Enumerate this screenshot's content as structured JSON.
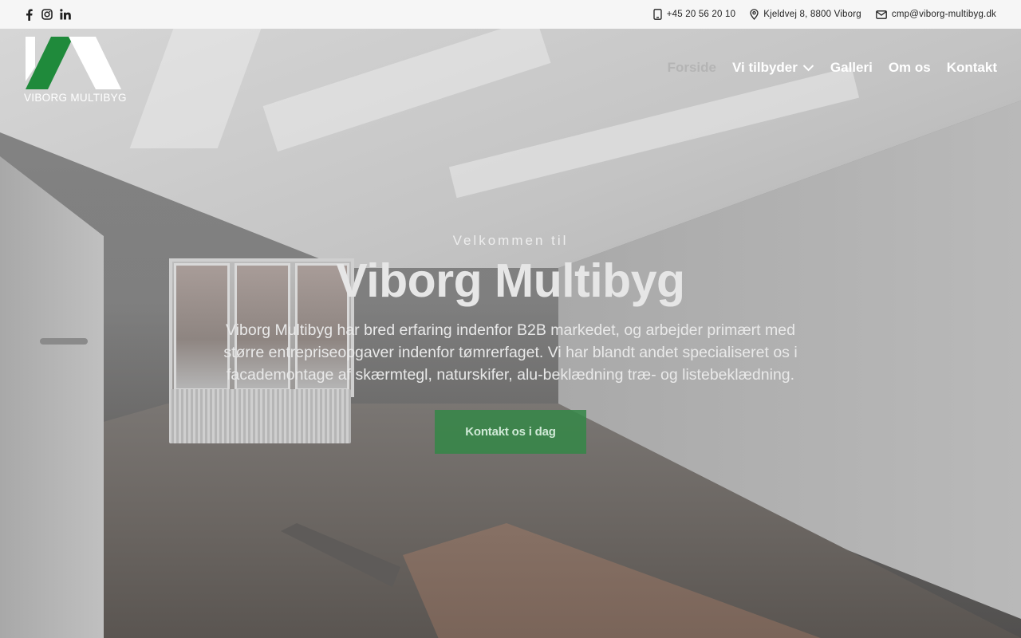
{
  "topbar": {
    "socials": [
      {
        "icon": "facebook-icon"
      },
      {
        "icon": "instagram-icon"
      },
      {
        "icon": "linkedin-icon"
      }
    ],
    "phone": "+45 20 56 20 10",
    "address": "Kjeldvej 8, 8800 Viborg",
    "email": "cmp@viborg-multibyg.dk"
  },
  "brand": {
    "name": "VIBORG MULTIBYG",
    "accent": "#1f8a3b"
  },
  "nav": {
    "items": [
      {
        "label": "Forside",
        "active": true
      },
      {
        "label": "Vi tilbyder",
        "dropdown": true
      },
      {
        "label": "Galleri"
      },
      {
        "label": "Om os"
      },
      {
        "label": "Kontakt"
      }
    ]
  },
  "hero": {
    "kicker": "Velkommen til",
    "title": "Viborg Multibyg",
    "description": "Viborg Multibyg har bred erfaring indenfor B2B markedet, og arbejder primært med større entrepriseopgaver indenfor tømrerfaget. Vi har blandt andet specialiseret os i facademontage af skærmtegl, naturskifer, alu-beklædning træ- og listebeklædning.",
    "cta_label": "Kontakt os i dag"
  }
}
